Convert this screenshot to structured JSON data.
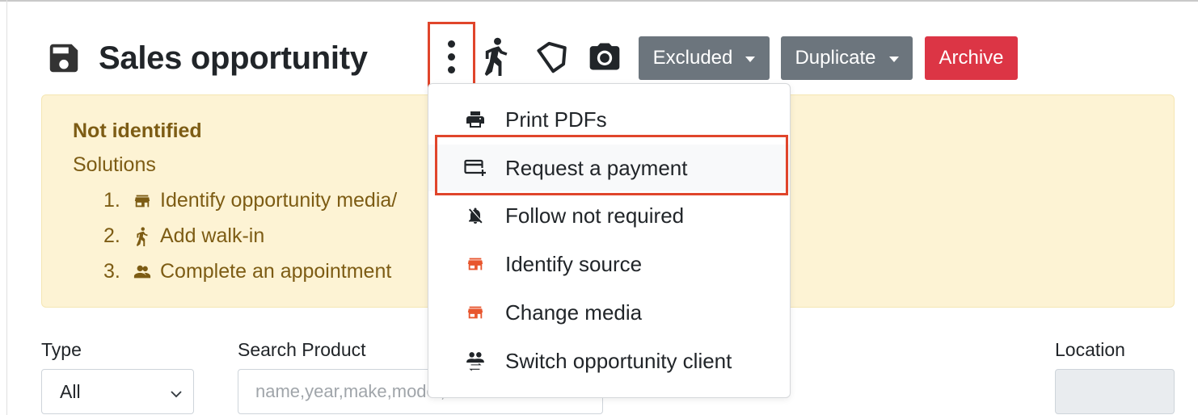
{
  "header": {
    "title": "Sales opportunity",
    "buttons": {
      "excluded": "Excluded",
      "duplicate": "Duplicate",
      "archive": "Archive"
    }
  },
  "alert": {
    "title": "Not identified",
    "subtitle": "Solutions",
    "items": [
      {
        "num": "1.",
        "label": "Identify opportunity media/",
        "icon": "store-icon"
      },
      {
        "num": "2.",
        "label": "Add walk-in",
        "icon": "walk-icon"
      },
      {
        "num": "3.",
        "label": "Complete an appointment",
        "icon": "people-icon"
      }
    ]
  },
  "filters": {
    "type_label": "Type",
    "type_value": "All",
    "search_label": "Search Product",
    "search_placeholder": "name,year,make,model,code or s",
    "location_label": "Location"
  },
  "menu": {
    "items": [
      {
        "label": "Print PDFs",
        "icon": "printer-icon"
      },
      {
        "label": "Request a payment",
        "icon": "card-plus-icon"
      },
      {
        "label": "Follow not required",
        "icon": "bell-off-icon"
      },
      {
        "label": "Identify source",
        "icon": "store-icon"
      },
      {
        "label": "Change media",
        "icon": "store-icon"
      },
      {
        "label": "Switch opportunity client",
        "icon": "people-swap-icon"
      }
    ]
  },
  "colors": {
    "highlight": "#e0452b",
    "button_gray": "#6c757d",
    "button_red": "#dc3545",
    "alert_bg": "#fdf3d4",
    "alert_text": "#7d5c14",
    "store_icon_orange": "#e8562e"
  }
}
